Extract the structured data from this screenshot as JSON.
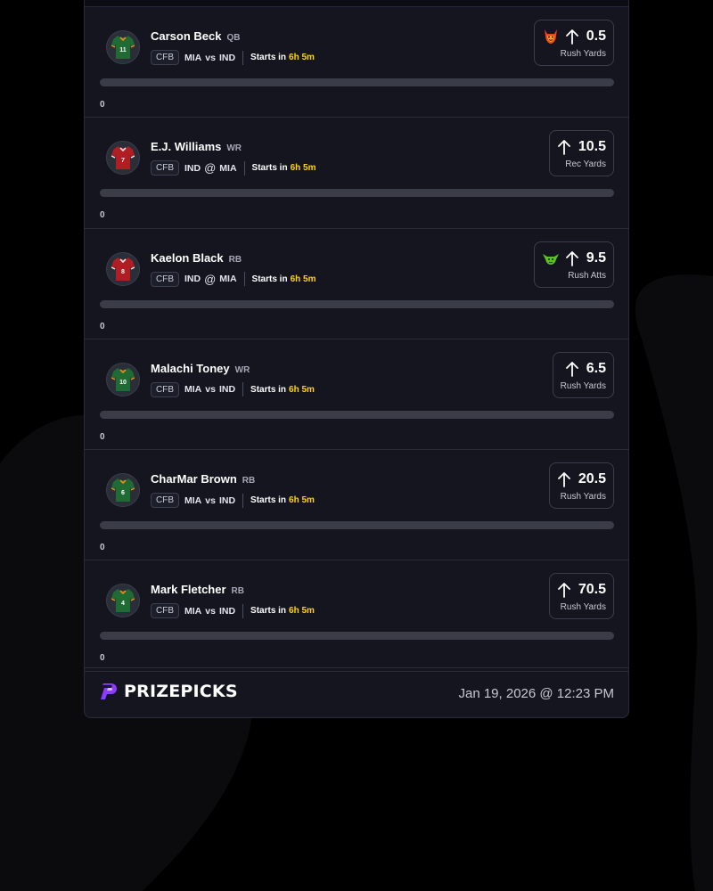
{
  "colors": {
    "accent_yellow": "#ffd400",
    "card_bg": "#14151f",
    "brand_purple": "#7a3cff",
    "progress_track": "#3a3c48"
  },
  "rows": [
    {
      "name": "Carson Beck",
      "pos": "QB",
      "jersey_number": "11",
      "jersey_color": "green",
      "league": "CFB",
      "team": "MIA",
      "sep": "vs",
      "opponent": "IND",
      "starts_label": "Starts in",
      "countdown": "6h 5m",
      "line": "0.5",
      "stat": "Rush Yards",
      "badge_icon": "demon-icon",
      "progress_value": "0"
    },
    {
      "name": "E.J. Williams",
      "pos": "WR",
      "jersey_number": "7",
      "jersey_color": "red",
      "league": "CFB",
      "team": "IND",
      "sep": "@",
      "opponent": "MIA",
      "starts_label": "Starts in",
      "countdown": "6h 5m",
      "line": "10.5",
      "stat": "Rec Yards",
      "badge_icon": "",
      "progress_value": "0"
    },
    {
      "name": "Kaelon Black",
      "pos": "RB",
      "jersey_number": "8",
      "jersey_color": "red",
      "league": "CFB",
      "team": "IND",
      "sep": "@",
      "opponent": "MIA",
      "starts_label": "Starts in",
      "countdown": "6h 5m",
      "line": "9.5",
      "stat": "Rush Atts",
      "badge_icon": "goblin-icon",
      "progress_value": "0"
    },
    {
      "name": "Malachi Toney",
      "pos": "WR",
      "jersey_number": "10",
      "jersey_color": "green",
      "league": "CFB",
      "team": "MIA",
      "sep": "vs",
      "opponent": "IND",
      "starts_label": "Starts in",
      "countdown": "6h 5m",
      "line": "6.5",
      "stat": "Rush Yards",
      "badge_icon": "",
      "progress_value": "0"
    },
    {
      "name": "CharMar Brown",
      "pos": "RB",
      "jersey_number": "6",
      "jersey_color": "green",
      "league": "CFB",
      "team": "MIA",
      "sep": "vs",
      "opponent": "IND",
      "starts_label": "Starts in",
      "countdown": "6h 5m",
      "line": "20.5",
      "stat": "Rush Yards",
      "badge_icon": "",
      "progress_value": "0"
    },
    {
      "name": "Mark Fletcher",
      "pos": "RB",
      "jersey_number": "4",
      "jersey_color": "green",
      "league": "CFB",
      "team": "MIA",
      "sep": "vs",
      "opponent": "IND",
      "starts_label": "Starts in",
      "countdown": "6h 5m",
      "line": "70.5",
      "stat": "Rush Yards",
      "badge_icon": "",
      "progress_value": "0"
    }
  ],
  "footer": {
    "brand": "PRIZEPICKS",
    "timestamp": "Jan 19, 2026 @ 12:23 PM"
  }
}
